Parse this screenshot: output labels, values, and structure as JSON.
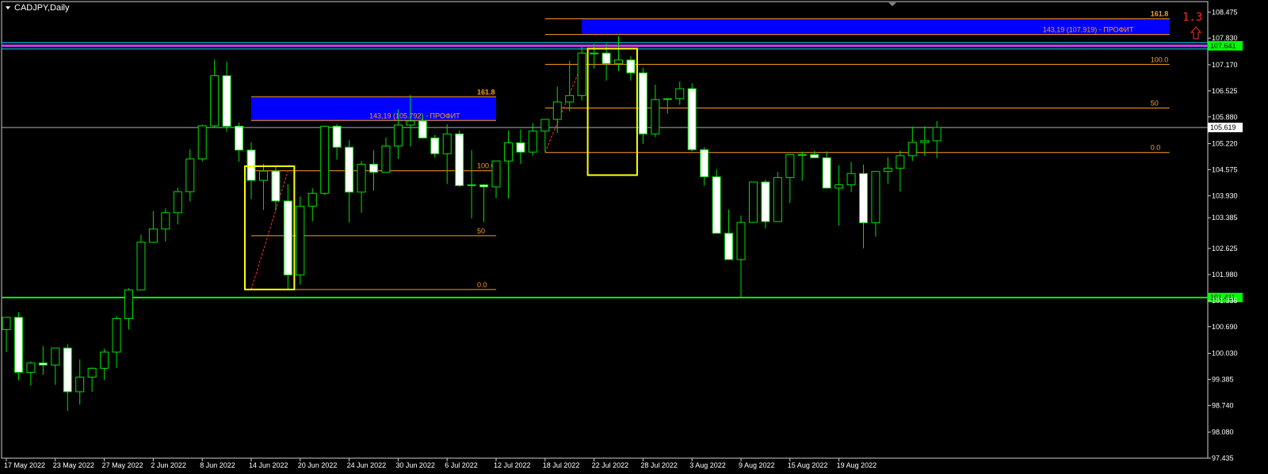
{
  "window": {
    "title": "CADJPY,Daily",
    "corner_label": "1.3"
  },
  "colors": {
    "background": "#000000",
    "bull_body": "#000000",
    "bull_border": "#00e000",
    "bear_body": "#ffffff",
    "wick": "#00e000",
    "fibo": "#ff9d1b",
    "profit_zone": "#0000ff",
    "support": "#00ff00",
    "resistance": "#d040ff",
    "current_price": "#a0b0c0",
    "highlight_box": "#ffff00"
  },
  "chart_data": {
    "type": "candlestick",
    "symbol": "CADJPY",
    "timeframe": "Daily",
    "ylim": [
      97.435,
      108.735
    ],
    "y_ticks": [
      "108.475",
      "107.830",
      "107.170",
      "106.525",
      "105.880",
      "105.220",
      "104.575",
      "103.930",
      "103.385",
      "102.625",
      "101.980",
      "101.335",
      "100.690",
      "100.030",
      "99.385",
      "98.740",
      "98.080",
      "97.435"
    ],
    "x_labels": [
      {
        "label": "17 May 2022",
        "index": 0
      },
      {
        "label": "23 May 2022",
        "index": 4
      },
      {
        "label": "27 May 2022",
        "index": 8
      },
      {
        "label": "2 Jun 2022",
        "index": 12
      },
      {
        "label": "8 Jun 2022",
        "index": 16
      },
      {
        "label": "14 Jun 2022",
        "index": 20
      },
      {
        "label": "20 Jun 2022",
        "index": 24
      },
      {
        "label": "24 Jun 2022",
        "index": 28
      },
      {
        "label": "30 Jun 2022",
        "index": 32
      },
      {
        "label": "6 Jul 2022",
        "index": 36
      },
      {
        "label": "12 Jul 2022",
        "index": 40
      },
      {
        "label": "18 Jul 2022",
        "index": 44
      },
      {
        "label": "22 Jul 2022",
        "index": 48
      },
      {
        "label": "28 Jul 2022",
        "index": 52
      },
      {
        "label": "3 Aug 2022",
        "index": 56
      },
      {
        "label": "9 Aug 2022",
        "index": 60
      },
      {
        "label": "15 Aug 2022",
        "index": 64
      },
      {
        "label": "19 Aug 2022",
        "index": 68
      }
    ],
    "candles": [
      [
        100.62,
        100.9,
        100.06,
        100.92
      ],
      [
        100.92,
        101.05,
        99.36,
        99.56
      ],
      [
        99.56,
        99.83,
        99.23,
        99.79
      ],
      [
        99.79,
        100.21,
        99.5,
        99.74
      ],
      [
        99.74,
        100.14,
        99.25,
        100.16
      ],
      [
        100.16,
        100.26,
        98.6,
        99.08
      ],
      [
        99.08,
        99.88,
        98.76,
        99.44
      ],
      [
        99.44,
        99.68,
        99.08,
        99.66
      ],
      [
        99.66,
        100.14,
        99.37,
        100.06
      ],
      [
        100.06,
        100.95,
        99.67,
        100.89
      ],
      [
        100.89,
        101.64,
        100.62,
        101.6
      ],
      [
        101.6,
        102.97,
        101.7,
        102.78
      ],
      [
        102.78,
        103.55,
        102.87,
        103.11
      ],
      [
        103.11,
        103.62,
        102.8,
        103.51
      ],
      [
        103.51,
        104.13,
        103.22,
        104.03
      ],
      [
        104.03,
        105.08,
        103.79,
        104.84
      ],
      [
        104.84,
        105.69,
        104.78,
        105.66
      ],
      [
        105.66,
        107.3,
        105.61,
        106.9
      ],
      [
        106.9,
        107.25,
        105.51,
        105.65
      ],
      [
        105.65,
        105.74,
        104.77,
        105.06
      ],
      [
        105.06,
        105.25,
        103.85,
        104.31
      ],
      [
        104.31,
        104.72,
        103.58,
        104.54
      ],
      [
        104.54,
        104.65,
        103.56,
        103.8
      ],
      [
        103.8,
        104.21,
        101.61,
        101.97
      ],
      [
        101.97,
        103.91,
        101.73,
        103.67
      ],
      [
        103.67,
        104.11,
        103.3,
        103.99
      ],
      [
        103.99,
        105.65,
        103.95,
        105.65
      ],
      [
        105.65,
        105.7,
        104.82,
        105.13
      ],
      [
        105.13,
        105.3,
        103.27,
        104.02
      ],
      [
        104.02,
        104.79,
        103.51,
        104.71
      ],
      [
        104.71,
        105.06,
        104.06,
        104.51
      ],
      [
        104.51,
        105.37,
        104.52,
        105.16
      ],
      [
        105.16,
        106.07,
        104.84,
        105.68
      ],
      [
        105.68,
        106.42,
        105.15,
        105.78
      ],
      [
        105.78,
        105.94,
        105.34,
        105.36
      ],
      [
        105.36,
        105.44,
        104.88,
        104.97
      ],
      [
        104.97,
        105.7,
        104.22,
        105.46
      ],
      [
        105.46,
        105.55,
        104.15,
        104.18
      ],
      [
        104.18,
        105.06,
        103.37,
        104.2
      ],
      [
        104.2,
        104.22,
        103.28,
        104.15
      ],
      [
        104.15,
        104.78,
        103.87,
        104.79
      ],
      [
        104.79,
        105.54,
        103.86,
        105.24
      ],
      [
        105.24,
        105.57,
        104.72,
        105.01
      ],
      [
        105.01,
        105.73,
        104.92,
        105.53
      ],
      [
        105.53,
        105.8,
        105.02,
        105.82
      ],
      [
        105.82,
        106.63,
        105.48,
        106.25
      ],
      [
        106.25,
        107.27,
        106.02,
        106.41
      ],
      [
        106.41,
        107.62,
        106.29,
        107.46
      ],
      [
        107.46,
        107.69,
        107.08,
        107.46
      ],
      [
        107.46,
        107.69,
        106.78,
        107.2
      ],
      [
        107.2,
        107.88,
        107.01,
        107.29
      ],
      [
        107.29,
        107.38,
        106.78,
        106.97
      ],
      [
        106.97,
        107.1,
        105.21,
        105.46
      ],
      [
        105.46,
        106.68,
        105.38,
        106.31
      ],
      [
        106.31,
        106.3,
        105.96,
        106.33
      ],
      [
        106.33,
        106.76,
        106.18,
        106.58
      ],
      [
        106.58,
        106.71,
        105.03,
        105.07
      ],
      [
        105.07,
        105.13,
        104.18,
        104.4
      ],
      [
        104.4,
        104.59,
        103.02,
        103.0
      ],
      [
        103.0,
        103.59,
        102.35,
        102.35
      ],
      [
        102.35,
        103.44,
        101.43,
        103.27
      ],
      [
        103.27,
        104.27,
        103.3,
        104.27
      ],
      [
        104.27,
        104.33,
        103.12,
        103.29
      ],
      [
        103.29,
        104.52,
        103.33,
        104.38
      ],
      [
        104.38,
        104.64,
        103.75,
        104.95
      ],
      [
        104.95,
        105.02,
        104.3,
        104.95
      ],
      [
        104.95,
        105.04,
        104.88,
        104.87
      ],
      [
        104.87,
        105.03,
        104.26,
        104.12
      ],
      [
        104.12,
        104.68,
        103.19,
        104.2
      ],
      [
        104.2,
        104.77,
        104.02,
        104.48
      ],
      [
        104.48,
        104.7,
        102.63,
        103.26
      ],
      [
        103.26,
        104.52,
        102.92,
        104.53
      ],
      [
        104.53,
        104.88,
        104.23,
        104.61
      ],
      [
        104.61,
        105.05,
        104.03,
        104.92
      ],
      [
        104.92,
        105.64,
        104.79,
        105.25
      ],
      [
        105.25,
        105.65,
        104.92,
        105.29
      ],
      [
        105.29,
        105.78,
        104.86,
        105.62
      ]
    ],
    "support_level": 101.411,
    "support_label": "101.411",
    "resistance_level": 107.641,
    "resistance_label": "107.641",
    "current_price": 105.619,
    "current_label": "105.619",
    "fibo_sets": [
      {
        "levels": [
          {
            "value": 101.61,
            "label": "0.0"
          },
          {
            "value": 102.94,
            "label": "50"
          },
          {
            "value": 104.55,
            "label": "100.0"
          },
          {
            "value": 106.38,
            "label": "161.8"
          }
        ],
        "profit_label": "143,19 (105.792) - ПРОФИТ",
        "profit_value": 105.792
      },
      {
        "levels": [
          {
            "value": 105.0,
            "label": "0.0"
          },
          {
            "value": 106.1,
            "label": "50"
          },
          {
            "value": 107.18,
            "label": "100.0"
          },
          {
            "value": 108.31,
            "label": "161.8"
          }
        ],
        "profit_label": "143,19 (107.919) - ПРОФИТ",
        "profit_value": 107.919
      }
    ],
    "highlight_boxes": [
      {
        "from_index": 20,
        "to_index": 23,
        "low": 101.61,
        "high": 104.66
      },
      {
        "from_index": 48,
        "to_index": 51,
        "low": 104.44,
        "high": 107.57
      }
    ]
  }
}
